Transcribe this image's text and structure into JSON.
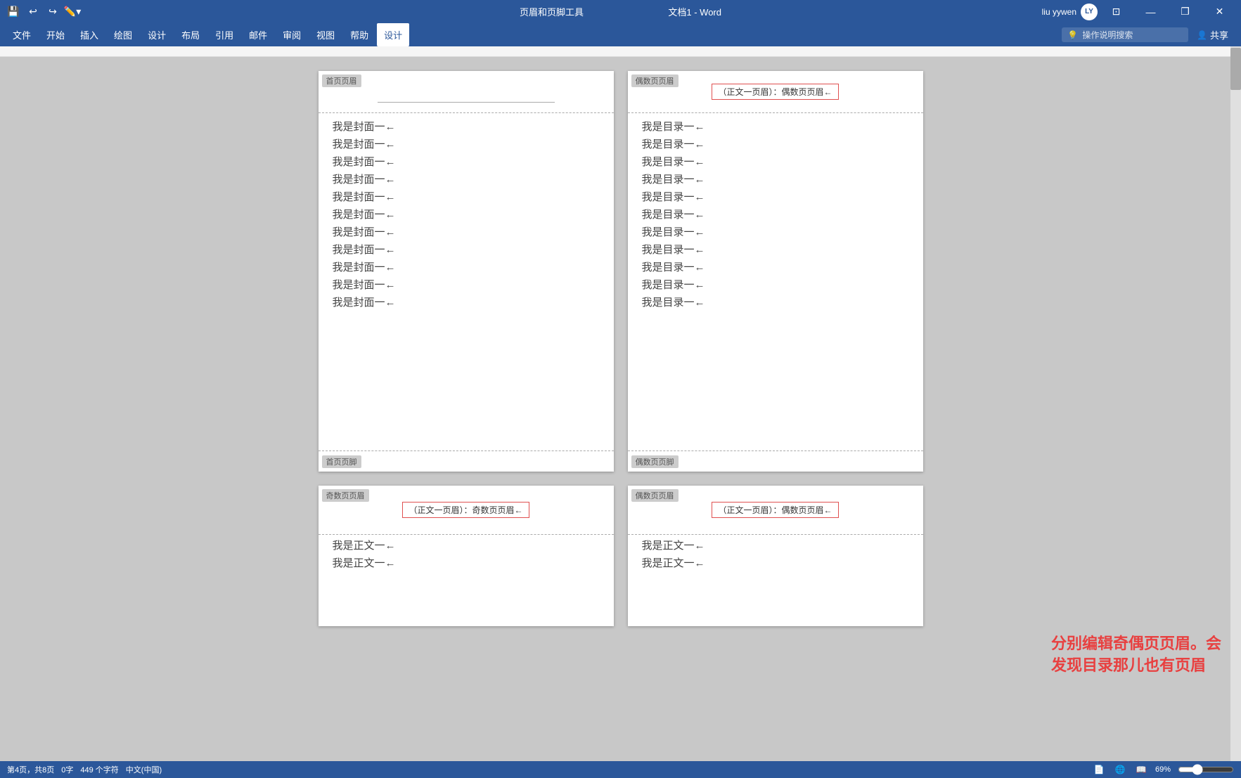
{
  "titlebar": {
    "title": "文档1 - Word",
    "subtitle": "页眉和页脚工具",
    "save_icon": "💾",
    "undo_icon": "↩",
    "redo_icon": "↪",
    "minimize_label": "—",
    "restore_label": "❐",
    "close_label": "✕",
    "user_name": "liu yywen",
    "user_initials": "LY"
  },
  "menu": {
    "items": [
      {
        "label": "文件",
        "active": false
      },
      {
        "label": "开始",
        "active": false
      },
      {
        "label": "插入",
        "active": false
      },
      {
        "label": "绘图",
        "active": false
      },
      {
        "label": "设计",
        "active": false
      },
      {
        "label": "布局",
        "active": false
      },
      {
        "label": "引用",
        "active": false
      },
      {
        "label": "邮件",
        "active": false
      },
      {
        "label": "审阅",
        "active": false
      },
      {
        "label": "视图",
        "active": false
      },
      {
        "label": "帮助",
        "active": false
      },
      {
        "label": "设计",
        "active": true
      }
    ],
    "search_placeholder": "操作说明搜索",
    "share_label": "共享"
  },
  "pages": {
    "row1": [
      {
        "id": "page1",
        "header_label": "首页页眉",
        "header_text": null,
        "content_lines": [
          "我是封面一←",
          "我是封面一←",
          "我是封面一←",
          "我是封面一←",
          "我是封面一←",
          "我是封面一←",
          "我是封面一←",
          "我是封面一←",
          "我是封面一←",
          "我是封面一←",
          "我是封面一←"
        ],
        "footer_label": "首页页脚"
      },
      {
        "id": "page2",
        "header_label": "偶数页页眉",
        "header_text": "（正文一页眉）：偶数页页眉←",
        "content_lines": [
          "我是目录一←",
          "我是目录一←",
          "我是目录一←",
          "我是目录一←",
          "我是目录一←",
          "我是目录一←",
          "我是目录一←",
          "我是目录一←",
          "我是目录一←",
          "我是目录一←",
          "我是目录一←"
        ],
        "footer_label": "偶数页页脚"
      }
    ],
    "row2": [
      {
        "id": "page3",
        "header_label": null,
        "header_text": "（正文一页眉）：奇数页页眉←",
        "header_label2": "奇数页页眉",
        "content_lines": [
          "我是正文一←",
          "我是正文一←"
        ],
        "footer_label": null
      },
      {
        "id": "page4",
        "header_label": null,
        "header_text": "（正文一页眉）：偶数页页眉←",
        "header_label2": "偶数页页眉",
        "content_lines": [
          "我是正文一←",
          "我是正文一←"
        ],
        "footer_label": null
      }
    ]
  },
  "annotation": {
    "text": "分别编辑奇偶页页眉。会发现目录那儿也有页眉"
  },
  "statusbar": {
    "page_info": "第4页，共8页",
    "word_count": "0字",
    "char_count": "449 个字符",
    "language": "中文(中国)",
    "zoom": "69%"
  }
}
